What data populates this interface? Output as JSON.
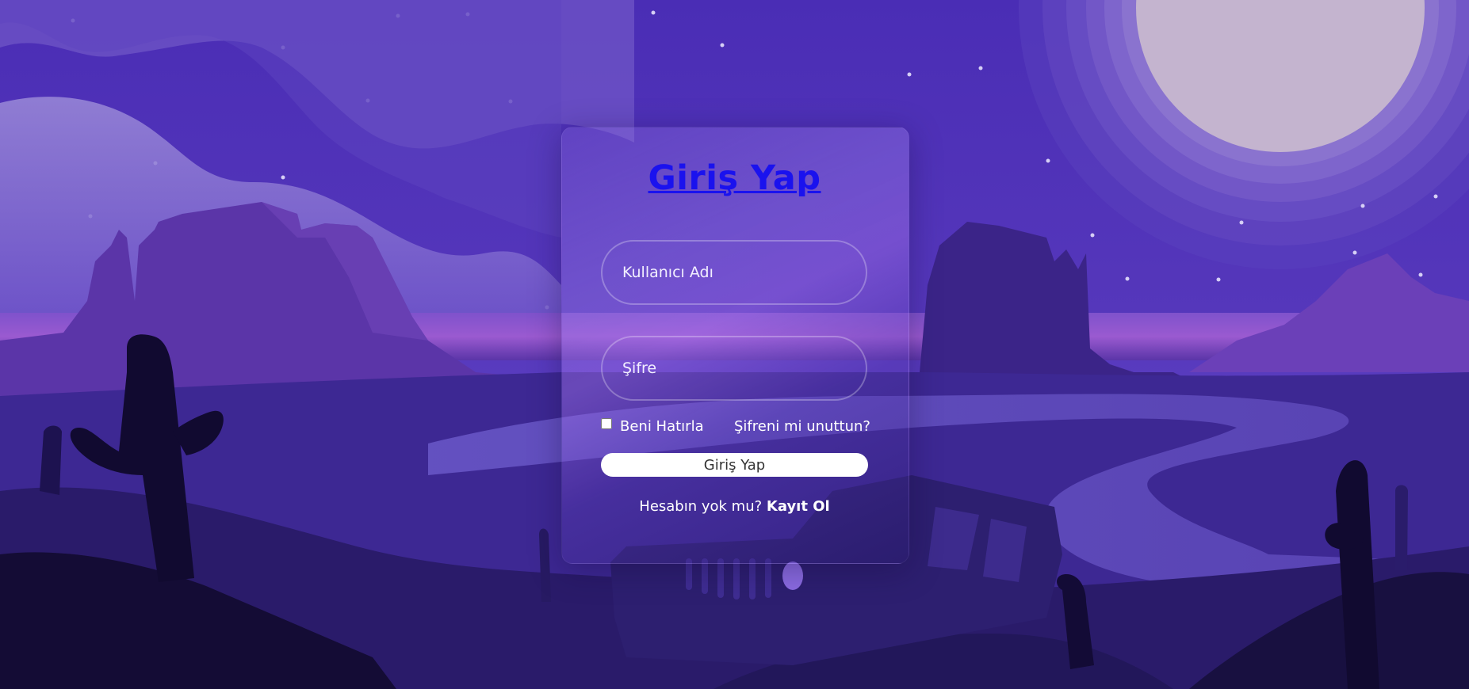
{
  "login": {
    "title": "Giriş Yap",
    "username_placeholder": "Kullanıcı Adı",
    "password_placeholder": "Şifre",
    "remember_label": "Beni Hatırla",
    "forgot_link": "Şifreni mi unuttun?",
    "submit_label": "Giriş Yap",
    "signup_prompt": "Hesabın yok mu?",
    "signup_link": "Kayıt Ol"
  },
  "colors": {
    "sky": "#4a2db3",
    "title_link": "#1a12ee",
    "moon": "#c4b4cf",
    "button_bg": "#ffffff",
    "button_text": "#333333"
  },
  "background": {
    "scene": "desert-night-illustration",
    "icons": [
      "moon-icon",
      "cactus-icon",
      "jeep-icon",
      "mesa-icon",
      "star-icon"
    ]
  }
}
